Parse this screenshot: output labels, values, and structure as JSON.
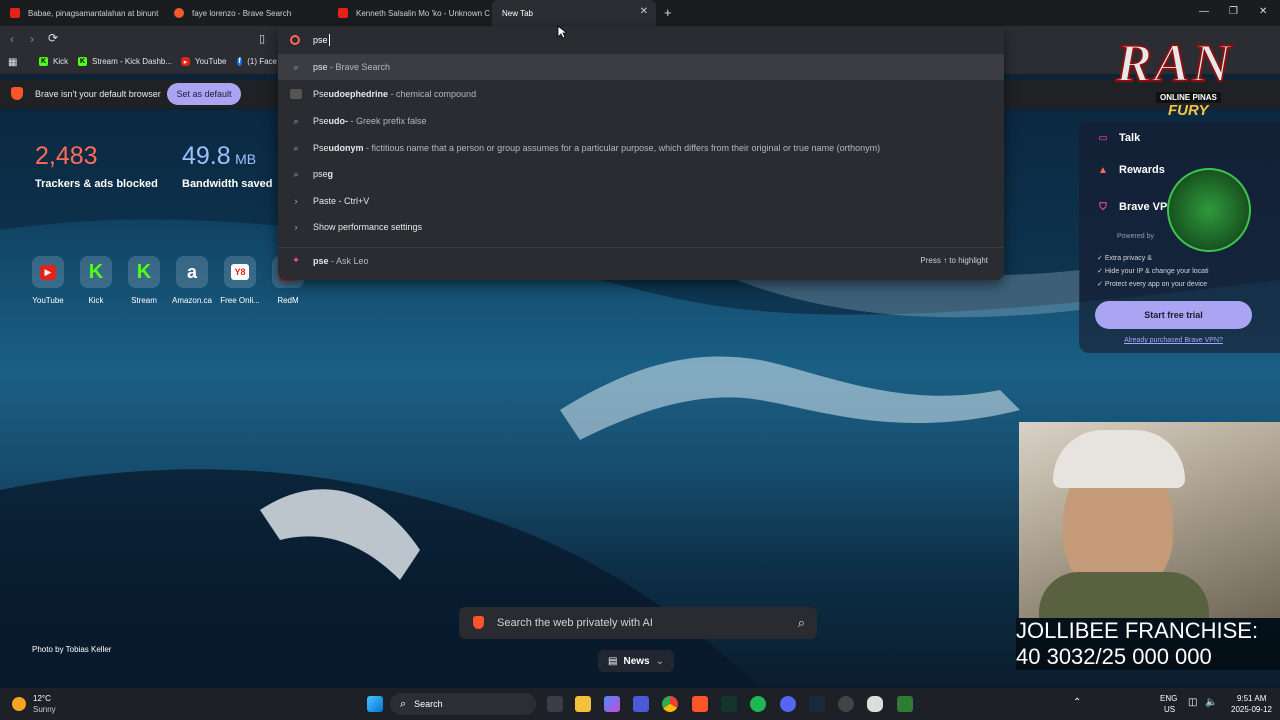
{
  "tabs": [
    {
      "label": "Babae, pinagsamantalahan at binunt",
      "color": "#e62117"
    },
    {
      "label": "faye lorenzo - Brave Search",
      "color": "#f25a2a"
    },
    {
      "label": "Kenneth Salsalin Mo 'ko - Unknown C",
      "color": "#e62117"
    },
    {
      "label": "New Tab",
      "color": ""
    }
  ],
  "omnibox": {
    "value": "pse",
    "suggestions": [
      {
        "icon": "search-icon",
        "match": "pse",
        "text": " - Brave Search"
      },
      {
        "icon": "image-icon",
        "match": "Pse",
        "bold": "udoephedrine",
        "desc": " - chemical compound"
      },
      {
        "icon": "search-icon",
        "match": "Pse",
        "bold": "udo-",
        "desc": " - Greek prefix false"
      },
      {
        "icon": "search-icon",
        "match": "Pse",
        "bold": "udonym",
        "desc": " - fictitious name that a person or group assumes for a particular purpose, which differs from their original or true name (orthonym)"
      },
      {
        "icon": "search-icon",
        "match": "pse",
        "bold": "g",
        "desc": ""
      },
      {
        "icon": "chevron-right-icon",
        "text": "Paste - Ctrl+V",
        "text_html": "P<b>a</b>st<b>e</b> - Ctrl+V"
      },
      {
        "icon": "chevron-right-icon",
        "text": "Show performance settings",
        "text_html": "Show <b>p</b>erformance <b>se</b>ttings"
      }
    ],
    "leo": {
      "match": "pse",
      "text": " - Ask Leo",
      "hint": "Press ↑ to highlight"
    }
  },
  "bookmarks": [
    {
      "label": "Kick",
      "color": "#53fc18"
    },
    {
      "label": "Stream - Kick Dashb...",
      "color": "#53fc18"
    },
    {
      "label": "YouTube",
      "color": "#e62117"
    },
    {
      "label": "(1) Face",
      "color": "#1877f2"
    }
  ],
  "infobar": {
    "message": "Brave isn't your default browser",
    "button": "Set as default"
  },
  "stats": {
    "trackers": {
      "value": "2,483",
      "label": "Trackers & ads blocked",
      "color": "#ff6b57"
    },
    "bandwidth": {
      "value": "49.8",
      "unit": "MB",
      "label": "Bandwidth saved",
      "color": "#9cc0ff"
    }
  },
  "top_sites": [
    {
      "label": "YouTube",
      "glyph": "▶",
      "color": "#e62117"
    },
    {
      "label": "Kick",
      "glyph": "K",
      "color": "#53fc18"
    },
    {
      "label": "Stream",
      "glyph": "K",
      "color": "#53fc18"
    },
    {
      "label": "Amazon.ca",
      "glyph": "a",
      "color": "#ffffff"
    },
    {
      "label": "Free Onli...",
      "glyph": "Y8",
      "color": "#ffffff"
    },
    {
      "label": "RedM",
      "glyph": "",
      "color": "#c21f1f"
    }
  ],
  "vpn_panel": {
    "talk": "Talk",
    "rewards": "Rewards",
    "vpn": "Brave VP",
    "powered": "Powered by",
    "features": [
      "Extra privacy &",
      "Hide your IP & change your locati",
      "Protect every app on your device"
    ],
    "trial": "Start free trial",
    "purchased": "Already purchased Brave VPN?"
  },
  "logo": {
    "text": "RAN",
    "sub": "ONLINE PINAS",
    "sub2": "FURY"
  },
  "photo_credit": "Photo by Tobias Keller",
  "search": {
    "placeholder": "Search the web privately with AI"
  },
  "news": "News",
  "overlay": {
    "line1": "JOLLIBEE FRANCHISE:",
    "line2": "40 3032/25 000 000"
  },
  "weather": {
    "temp": "12°C",
    "cond": "Sunny"
  },
  "taskbar": {
    "search": "Search",
    "lang1": "ENG",
    "lang2": "US",
    "time": "9:51 AM",
    "date": "2025-09-12"
  },
  "colors": {
    "accent": "#a9a5f2",
    "brave": "#fb542b"
  }
}
